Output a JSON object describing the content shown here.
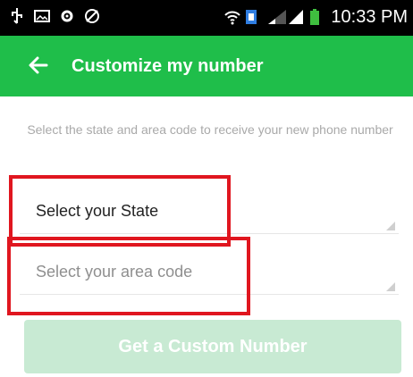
{
  "status_bar": {
    "time": "10:33 PM",
    "left_icons": [
      "usb-icon",
      "image-icon",
      "settings-icon",
      "no-signal-icon"
    ],
    "right_icons": [
      "wifi-icon",
      "sim-icon",
      "signal-icon",
      "signal-icon",
      "battery-icon"
    ]
  },
  "app_bar": {
    "title": "Customize my number",
    "back_icon": "arrow-left-icon",
    "background": "#1fbe4a"
  },
  "form": {
    "description": "Select the state and area code to receive your new phone number",
    "state_select": {
      "value": "Select your State"
    },
    "area_code_select": {
      "value": "Select your area code"
    },
    "submit_label": "Get a Custom Number",
    "submit_color": "#c8ead3"
  },
  "highlight_color": "#e0161f"
}
